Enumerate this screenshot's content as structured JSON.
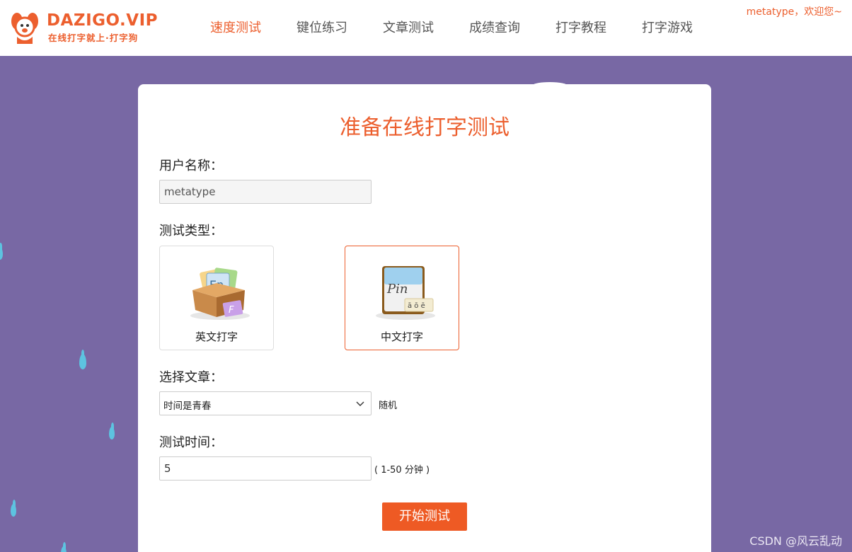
{
  "header": {
    "logo_title": "DAZIGO.VIP",
    "logo_subtitle": "在线打字就上·打字狗",
    "nav": [
      {
        "label": "速度测试",
        "active": true
      },
      {
        "label": "键位练习",
        "active": false
      },
      {
        "label": "文章测试",
        "active": false
      },
      {
        "label": "成绩查询",
        "active": false
      },
      {
        "label": "打字教程",
        "active": false
      },
      {
        "label": "打字游戏",
        "active": false
      }
    ],
    "welcome": "metatype，欢迎您~"
  },
  "form": {
    "title": "准备在线打字测试",
    "username_label": "用户名称：",
    "username_value": "metatype",
    "type_label": "测试类型：",
    "types": [
      {
        "label": "英文打字",
        "icon": "english-typing-box-icon",
        "selected": false
      },
      {
        "label": "中文打字",
        "icon": "pinyin-book-icon",
        "selected": true
      }
    ],
    "article_label": "选择文章：",
    "article_selected": "时间是青春",
    "random_label": "随机",
    "time_label": "测试时间：",
    "time_value": "5",
    "time_hint": "( 1-50 分钟 )",
    "start_button": "开始测试"
  },
  "watermark": "CSDN @风云乱动",
  "colors": {
    "accent": "#ec5f2e",
    "background": "#7868a4",
    "raindrop": "#5dc3e0"
  }
}
